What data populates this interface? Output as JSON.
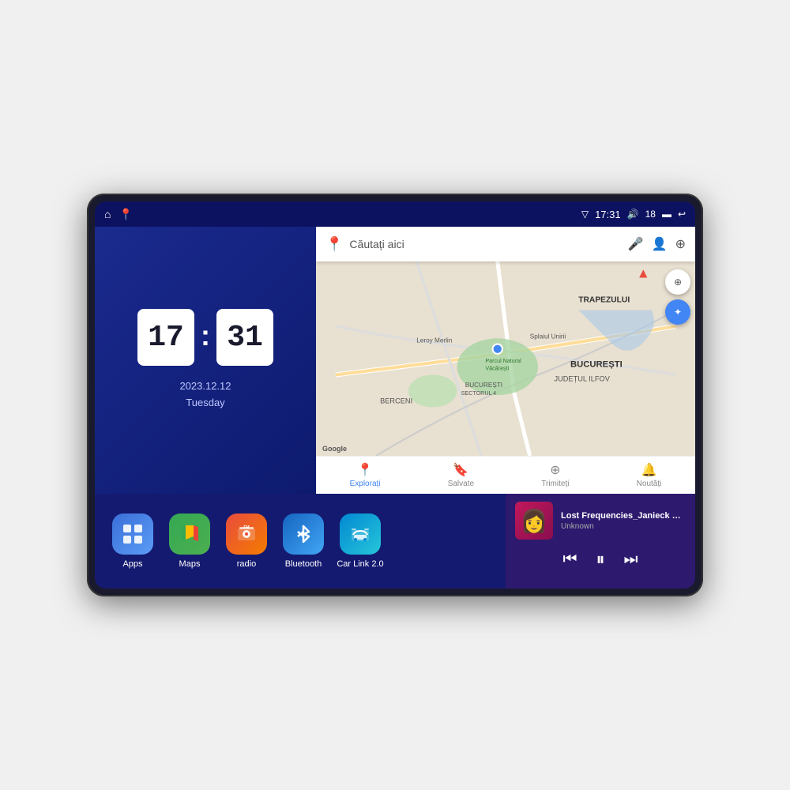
{
  "device": {
    "screen": {
      "status_bar": {
        "left_icons": [
          "home",
          "maps"
        ],
        "time": "17:31",
        "signal_icon": "▽",
        "volume_icon": "🔊",
        "volume_level": "18",
        "battery_icon": "🔋",
        "back_icon": "↩"
      },
      "clock": {
        "hours": "17",
        "minutes": "31",
        "date": "2023.12.12",
        "day": "Tuesday"
      },
      "map": {
        "search_placeholder": "Căutați aici",
        "location": "București",
        "district": "Județul Ilfov",
        "nav_items": [
          {
            "label": "Explorați",
            "active": true
          },
          {
            "label": "Salvate",
            "active": false
          },
          {
            "label": "Trimiteți",
            "active": false
          },
          {
            "label": "Noutăți",
            "active": false
          }
        ]
      },
      "apps": [
        {
          "id": "apps",
          "label": "Apps",
          "icon_type": "apps"
        },
        {
          "id": "maps",
          "label": "Maps",
          "icon_type": "maps"
        },
        {
          "id": "radio",
          "label": "radio",
          "icon_type": "radio"
        },
        {
          "id": "bluetooth",
          "label": "Bluetooth",
          "icon_type": "bluetooth"
        },
        {
          "id": "carlink",
          "label": "Car Link 2.0",
          "icon_type": "carlink"
        }
      ],
      "music": {
        "title": "Lost Frequencies_Janieck Devy-...",
        "artist": "Unknown",
        "prev_label": "⏮",
        "play_label": "⏸",
        "next_label": "⏭"
      }
    }
  }
}
